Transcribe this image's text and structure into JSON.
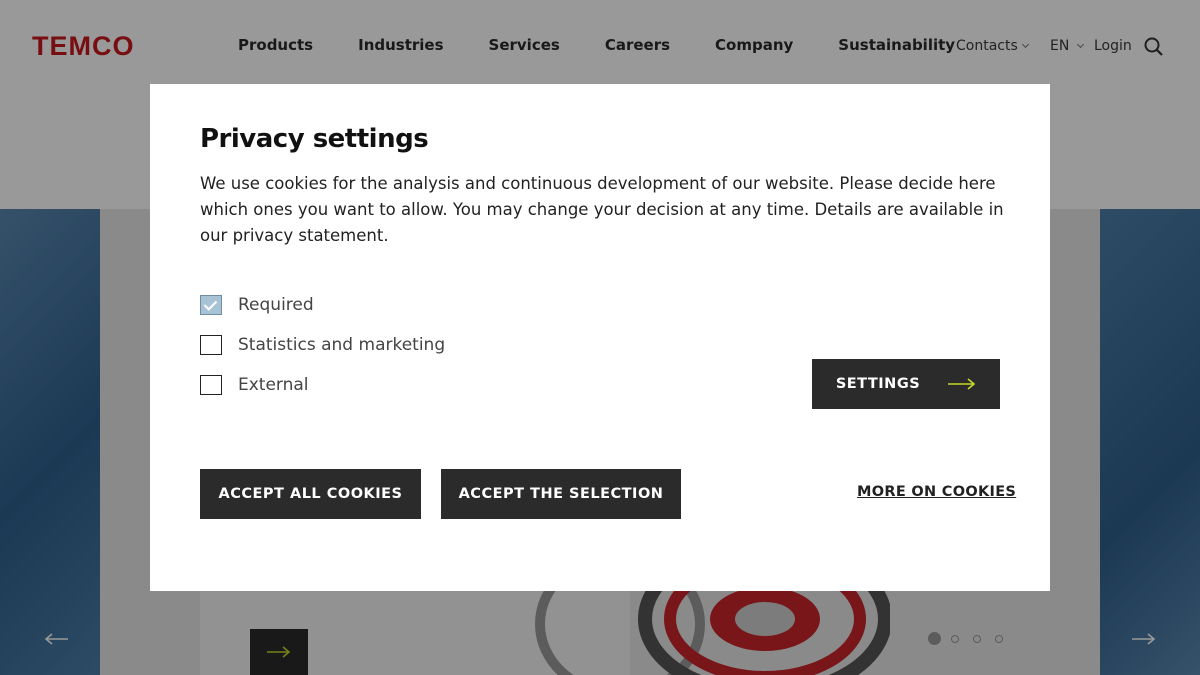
{
  "header": {
    "logo": "TEMCO",
    "nav": [
      "Products",
      "Industries",
      "Services",
      "Careers",
      "Company",
      "Sustainability"
    ],
    "contacts": "Contacts",
    "language": "EN",
    "login": "Login"
  },
  "hero": {
    "dots_total": 4,
    "active_dot": 1
  },
  "modal": {
    "title": "Privacy settings",
    "description": "We use cookies for the analysis and continuous development of our website. Please decide here which ones you want to allow. You may change your decision at any time. Details are available in our privacy statement.",
    "options": [
      {
        "label": "Required",
        "checked": true
      },
      {
        "label": "Statistics and marketing",
        "checked": false
      },
      {
        "label": "External",
        "checked": false
      }
    ],
    "settings_button": "SETTINGS",
    "accept_all_button": "ACCEPT ALL COOKIES",
    "accept_selection_button": "ACCEPT THE SELECTION",
    "more_link": "MORE ON COOKIES"
  },
  "colors": {
    "brand_red": "#c8181e",
    "button_dark": "#2b2b2b",
    "accent_yellow": "#c6d82b",
    "checked_box": "#a9c3d6"
  }
}
